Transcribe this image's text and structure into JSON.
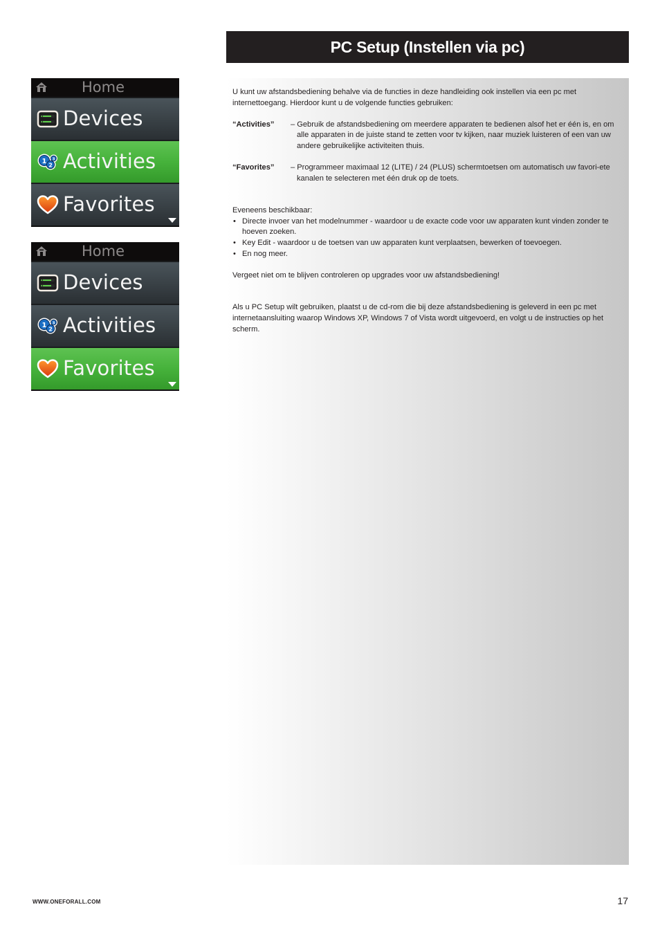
{
  "header": {
    "title": "PC Setup (Instellen via pc)"
  },
  "screens": [
    {
      "header_label": "Home",
      "header_icon": "home-icon",
      "items": [
        {
          "label": "Devices",
          "icon": "devices-icon",
          "active": false
        },
        {
          "label": "Activities",
          "icon": "activities-icon",
          "active": true
        },
        {
          "label": "Favorites",
          "icon": "favorites-heart-icon",
          "active": false
        }
      ],
      "scroll_indicator": "scroll-down-arrow-icon"
    },
    {
      "header_label": "Home",
      "header_icon": "home-icon",
      "items": [
        {
          "label": "Devices",
          "icon": "devices-icon",
          "active": false
        },
        {
          "label": "Activities",
          "icon": "activities-icon",
          "active": false
        },
        {
          "label": "Favorites",
          "icon": "favorites-heart-icon",
          "active": true
        }
      ],
      "scroll_indicator": "scroll-down-arrow-icon"
    }
  ],
  "content": {
    "intro": "U kunt uw afstandsbediening behalve via de functies in deze handleiding ook instellen via een pc met internettoegang. Hierdoor kunt u de volgende functies gebruiken:",
    "definitions": [
      {
        "term": "“Activities”",
        "description": "– Gebruik de afstandsbediening om meerdere apparaten te bedienen alsof het er één is, en om alle apparaten in de juiste stand te zetten voor tv kijken, naar muziek luisteren of een van uw andere gebruikelijke activiteiten thuis."
      },
      {
        "term": "“Favorites”",
        "description": "– Programmeer maximaal 12 (LITE) / 24 (PLUS) schermtoetsen om automatisch uw favori-ete kanalen te selecteren met één druk op de toets."
      }
    ],
    "also_available_heading": "Eveneens beschikbaar:",
    "bullets": [
      "Directe invoer van het modelnummer - waardoor u de exacte code voor uw apparaten kunt vinden zonder te hoeven zoeken.",
      "Key Edit - waardoor u de toetsen van uw apparaten kunt verplaatsen, bewerken of toevoegen.",
      "En nog meer."
    ],
    "bullet_char": "•",
    "reminder": "Vergeet niet om te blijven controleren op upgrades voor uw afstandsbediening!",
    "instructions": "Als u PC Setup wilt gebruiken, plaatst u de cd-rom die bij deze afstandsbediening is geleverd in een pc met internetaansluiting waarop Windows XP,  Windows 7 of Vista wordt uitgevoerd, en volgt u de instructies op het scherm."
  },
  "footer": {
    "url": "WWW.ONEFORALL.COM",
    "page_number": "17"
  },
  "colors": {
    "title_bar": "#231f20",
    "active_item": "#46b23b",
    "inactive_item": "#3a4247",
    "panel_gradient_end": "#c6c6c6"
  }
}
